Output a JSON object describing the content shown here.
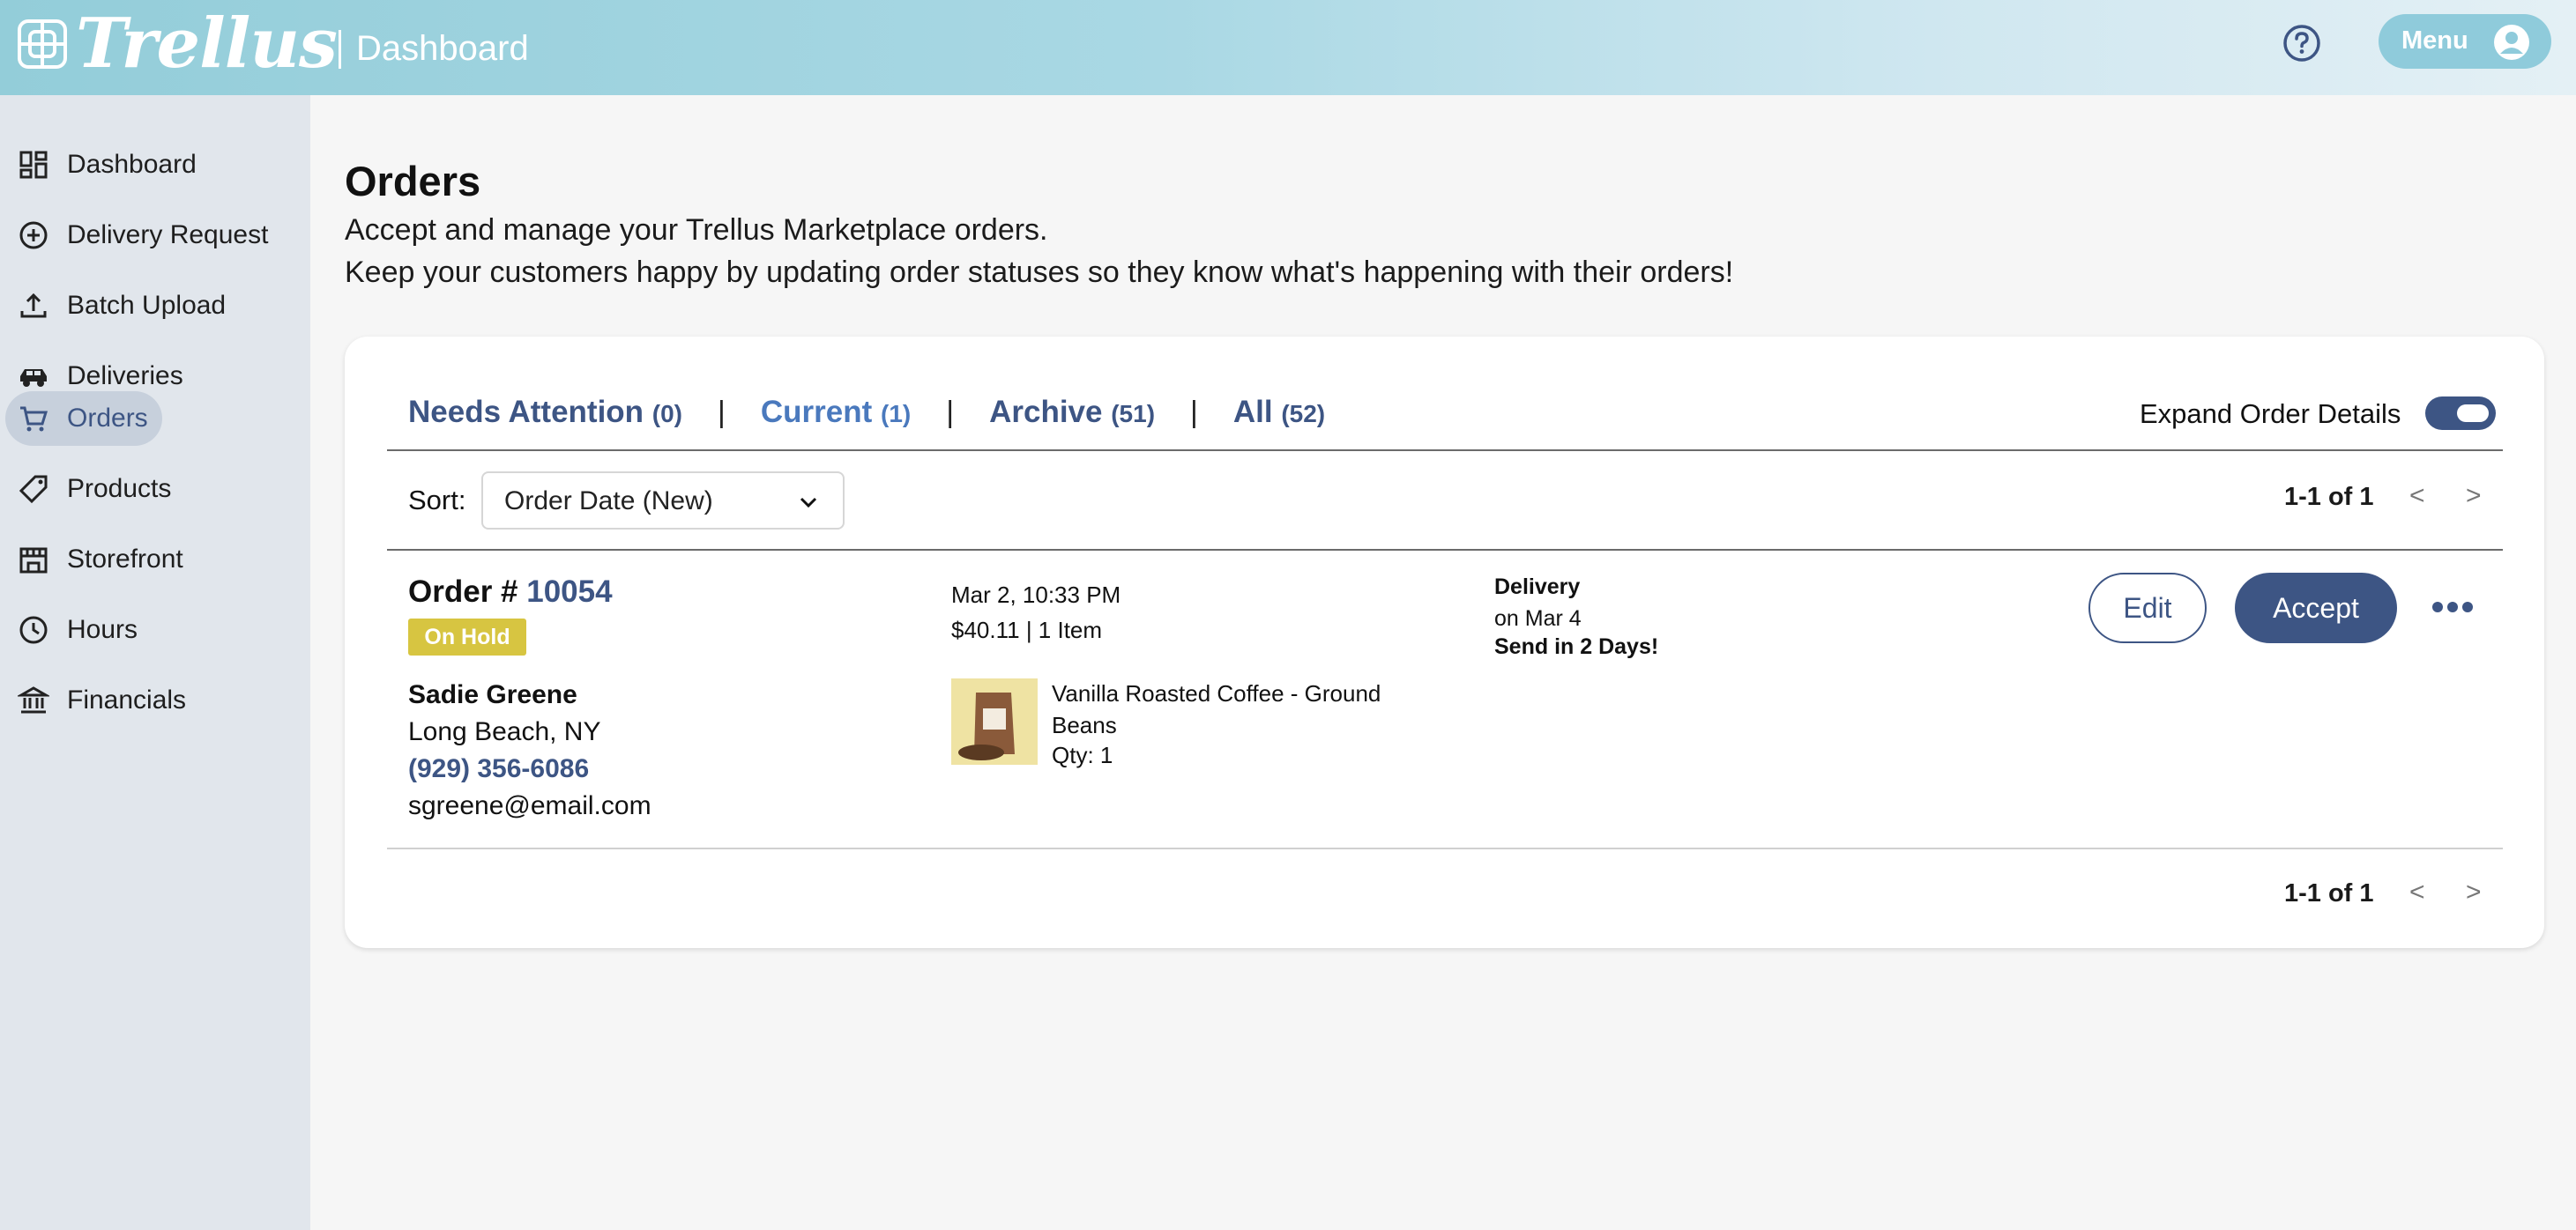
{
  "header": {
    "logo_text": "Trellus",
    "section": "Dashboard",
    "menu_label": "Menu",
    "colors": {
      "brand": "#3d5584",
      "header_bg": "#a9d8e4"
    }
  },
  "sidebar": {
    "items": [
      {
        "label": "Dashboard",
        "icon": "grid-icon"
      },
      {
        "label": "Delivery Request",
        "icon": "plus-circle-icon"
      },
      {
        "label": "Batch Upload",
        "icon": "upload-icon"
      },
      {
        "label": "Deliveries",
        "icon": "car-icon"
      },
      {
        "label": "Orders",
        "icon": "cart-icon",
        "active": true
      },
      {
        "label": "Products",
        "icon": "tag-icon"
      },
      {
        "label": "Storefront",
        "icon": "store-icon"
      },
      {
        "label": "Hours",
        "icon": "clock-icon"
      },
      {
        "label": "Financials",
        "icon": "bank-icon"
      }
    ]
  },
  "main": {
    "title": "Orders",
    "subtitle_1": "Accept and manage your Trellus Marketplace orders.",
    "subtitle_2": "Keep your customers happy by updating order statuses so they know what's happening with their orders!"
  },
  "tabs": [
    {
      "label": "Needs Attention",
      "count": "(0)"
    },
    {
      "label": "Current",
      "count": "(1)",
      "active": true
    },
    {
      "label": "Archive",
      "count": "(51)"
    },
    {
      "label": "All",
      "count": "(52)"
    }
  ],
  "tab_separator": "|",
  "expand": {
    "label": "Expand Order Details",
    "enabled": true
  },
  "sort": {
    "label": "Sort:",
    "value": "Order Date (New)"
  },
  "pagination": {
    "range": "1-1 of 1",
    "prev": "<",
    "next": ">"
  },
  "order": {
    "title_prefix": "Order #",
    "number": "10054",
    "status": "On Hold",
    "customer": {
      "name": "Sadie Greene",
      "location": "Long Beach, NY",
      "phone": "(929) 356-6086",
      "email": "sgreene@email.com"
    },
    "date": "Mar 2, 10:33 PM",
    "summary": "$40.11 | 1 Item",
    "product": {
      "name": "Vanilla Roasted Coffee - Ground Beans",
      "qty": "Qty: 1"
    },
    "delivery": {
      "type": "Delivery",
      "date": "on Mar 4",
      "note": "Send in 2 Days!"
    },
    "actions": {
      "edit": "Edit",
      "accept": "Accept",
      "more_icon": "ellipsis-icon"
    }
  }
}
